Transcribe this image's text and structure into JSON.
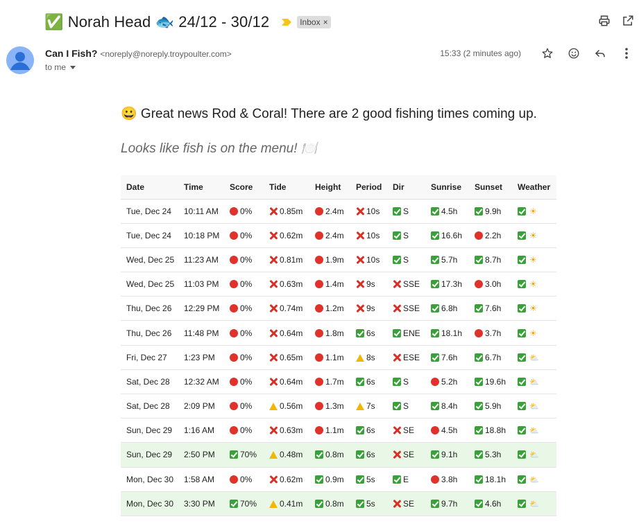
{
  "subject": "✅ Norah Head 🐟 24/12 - 30/12",
  "label": "Inbox",
  "sender": {
    "name": "Can I Fish?",
    "email": "<noreply@noreply.troypoulter.com>",
    "to": "to me",
    "time": "15:33 (2 minutes ago)"
  },
  "message": {
    "greeting": "😀 Great news Rod & Coral! There are 2 good fishing times coming up.",
    "subline": "Looks like fish is on the menu! 🍽️"
  },
  "table": {
    "headers": [
      "Date",
      "Time",
      "Score",
      "Tide",
      "Height",
      "Period",
      "Dir",
      "Sunrise",
      "Sunset",
      "Weather"
    ],
    "rows": [
      {
        "good": false,
        "cells": [
          [
            "",
            "Tue, Dec 24"
          ],
          [
            "",
            "10:11 AM"
          ],
          [
            "stop",
            "0%"
          ],
          [
            "bad",
            "0.85m"
          ],
          [
            "stop",
            "2.4m"
          ],
          [
            "bad",
            "10s"
          ],
          [
            "ok",
            "S"
          ],
          [
            "ok",
            "4.5h"
          ],
          [
            "ok",
            "9.9h"
          ],
          [
            "ok",
            "sun"
          ]
        ]
      },
      {
        "good": false,
        "cells": [
          [
            "",
            "Tue, Dec 24"
          ],
          [
            "",
            "10:18 PM"
          ],
          [
            "stop",
            "0%"
          ],
          [
            "bad",
            "0.62m"
          ],
          [
            "stop",
            "2.4m"
          ],
          [
            "bad",
            "10s"
          ],
          [
            "ok",
            "S"
          ],
          [
            "ok",
            "16.6h"
          ],
          [
            "stop",
            "2.2h"
          ],
          [
            "ok",
            "sun"
          ]
        ]
      },
      {
        "good": false,
        "cells": [
          [
            "",
            "Wed, Dec 25"
          ],
          [
            "",
            "11:23 AM"
          ],
          [
            "stop",
            "0%"
          ],
          [
            "bad",
            "0.81m"
          ],
          [
            "stop",
            "1.9m"
          ],
          [
            "bad",
            "10s"
          ],
          [
            "ok",
            "S"
          ],
          [
            "ok",
            "5.7h"
          ],
          [
            "ok",
            "8.7h"
          ],
          [
            "ok",
            "sun"
          ]
        ]
      },
      {
        "good": false,
        "cells": [
          [
            "",
            "Wed, Dec 25"
          ],
          [
            "",
            "11:03 PM"
          ],
          [
            "stop",
            "0%"
          ],
          [
            "bad",
            "0.63m"
          ],
          [
            "stop",
            "1.4m"
          ],
          [
            "bad",
            "9s"
          ],
          [
            "bad",
            "SSE"
          ],
          [
            "ok",
            "17.3h"
          ],
          [
            "stop",
            "3.0h"
          ],
          [
            "ok",
            "sun"
          ]
        ]
      },
      {
        "good": false,
        "cells": [
          [
            "",
            "Thu, Dec 26"
          ],
          [
            "",
            "12:29 PM"
          ],
          [
            "stop",
            "0%"
          ],
          [
            "bad",
            "0.74m"
          ],
          [
            "stop",
            "1.2m"
          ],
          [
            "bad",
            "9s"
          ],
          [
            "bad",
            "SSE"
          ],
          [
            "ok",
            "6.8h"
          ],
          [
            "ok",
            "7.6h"
          ],
          [
            "ok",
            "sun"
          ]
        ]
      },
      {
        "good": false,
        "cells": [
          [
            "",
            "Thu, Dec 26"
          ],
          [
            "",
            "11:48 PM"
          ],
          [
            "stop",
            "0%"
          ],
          [
            "bad",
            "0.64m"
          ],
          [
            "stop",
            "1.8m"
          ],
          [
            "ok",
            "6s"
          ],
          [
            "ok",
            "ENE"
          ],
          [
            "ok",
            "18.1h"
          ],
          [
            "stop",
            "3.7h"
          ],
          [
            "ok",
            "sun"
          ]
        ]
      },
      {
        "good": false,
        "cells": [
          [
            "",
            "Fri, Dec 27"
          ],
          [
            "",
            "1:23 PM"
          ],
          [
            "stop",
            "0%"
          ],
          [
            "bad",
            "0.65m"
          ],
          [
            "stop",
            "1.1m"
          ],
          [
            "warn",
            "8s"
          ],
          [
            "bad",
            "ESE"
          ],
          [
            "ok",
            "7.6h"
          ],
          [
            "ok",
            "6.7h"
          ],
          [
            "ok",
            "cloud"
          ]
        ]
      },
      {
        "good": false,
        "cells": [
          [
            "",
            "Sat, Dec 28"
          ],
          [
            "",
            "12:32 AM"
          ],
          [
            "stop",
            "0%"
          ],
          [
            "bad",
            "0.64m"
          ],
          [
            "stop",
            "1.7m"
          ],
          [
            "ok",
            "6s"
          ],
          [
            "ok",
            "S"
          ],
          [
            "stop",
            "5.2h"
          ],
          [
            "ok",
            "19.6h"
          ],
          [
            "ok",
            "cloud"
          ]
        ]
      },
      {
        "good": false,
        "cells": [
          [
            "",
            "Sat, Dec 28"
          ],
          [
            "",
            "2:09 PM"
          ],
          [
            "stop",
            "0%"
          ],
          [
            "warn",
            "0.56m"
          ],
          [
            "stop",
            "1.3m"
          ],
          [
            "warn",
            "7s"
          ],
          [
            "ok",
            "S"
          ],
          [
            "ok",
            "8.4h"
          ],
          [
            "ok",
            "5.9h"
          ],
          [
            "ok",
            "cloud"
          ]
        ]
      },
      {
        "good": false,
        "cells": [
          [
            "",
            "Sun, Dec 29"
          ],
          [
            "",
            "1:16 AM"
          ],
          [
            "stop",
            "0%"
          ],
          [
            "bad",
            "0.63m"
          ],
          [
            "stop",
            "1.1m"
          ],
          [
            "ok",
            "6s"
          ],
          [
            "bad",
            "SE"
          ],
          [
            "stop",
            "4.5h"
          ],
          [
            "ok",
            "18.8h"
          ],
          [
            "ok",
            "cloud"
          ]
        ]
      },
      {
        "good": true,
        "cells": [
          [
            "",
            "Sun, Dec 29"
          ],
          [
            "",
            "2:50 PM"
          ],
          [
            "ok",
            "70%"
          ],
          [
            "warn",
            "0.48m"
          ],
          [
            "ok",
            "0.8m"
          ],
          [
            "ok",
            "6s"
          ],
          [
            "bad",
            "SE"
          ],
          [
            "ok",
            "9.1h"
          ],
          [
            "ok",
            "5.3h"
          ],
          [
            "ok",
            "cloud"
          ]
        ]
      },
      {
        "good": false,
        "cells": [
          [
            "",
            "Mon, Dec 30"
          ],
          [
            "",
            "1:58 AM"
          ],
          [
            "stop",
            "0%"
          ],
          [
            "bad",
            "0.62m"
          ],
          [
            "ok",
            "0.9m"
          ],
          [
            "ok",
            "5s"
          ],
          [
            "ok",
            "E"
          ],
          [
            "stop",
            "3.8h"
          ],
          [
            "ok",
            "18.1h"
          ],
          [
            "ok",
            "cloud"
          ]
        ]
      },
      {
        "good": true,
        "cells": [
          [
            "",
            "Mon, Dec 30"
          ],
          [
            "",
            "3:30 PM"
          ],
          [
            "ok",
            "70%"
          ],
          [
            "warn",
            "0.41m"
          ],
          [
            "ok",
            "0.8m"
          ],
          [
            "ok",
            "5s"
          ],
          [
            "bad",
            "SE"
          ],
          [
            "ok",
            "9.7h"
          ],
          [
            "ok",
            "4.6h"
          ],
          [
            "ok",
            "cloud"
          ]
        ]
      }
    ]
  }
}
